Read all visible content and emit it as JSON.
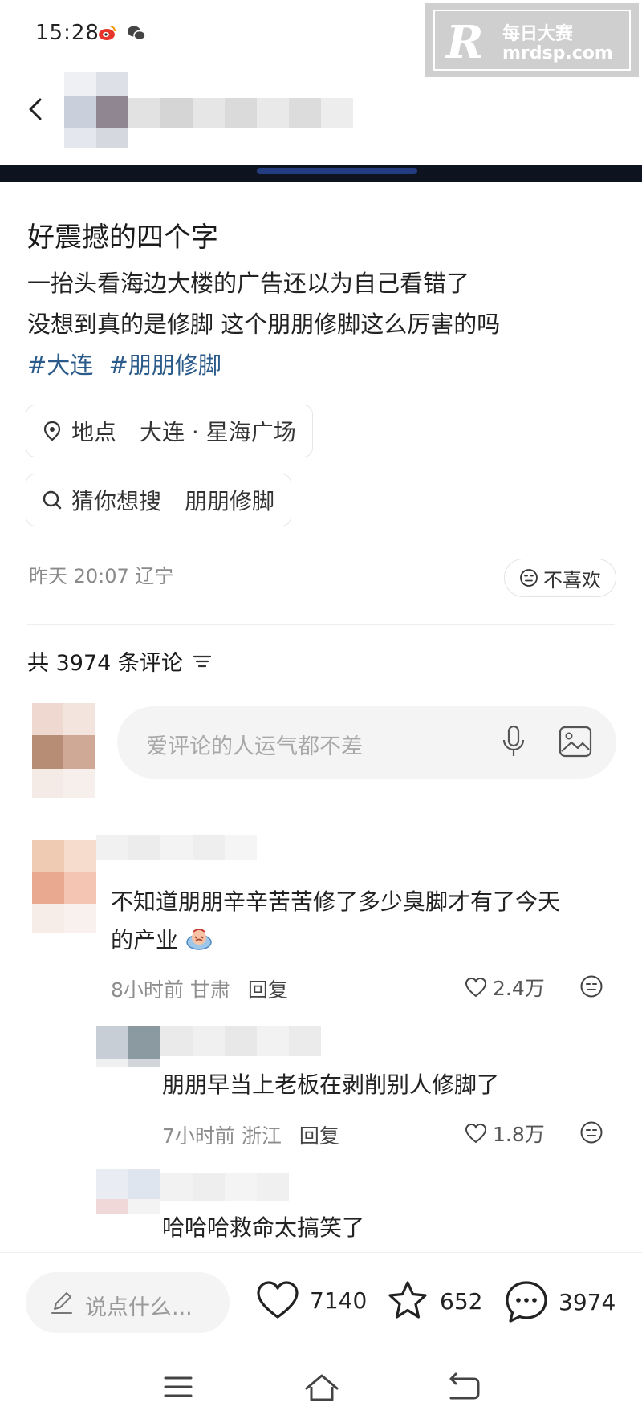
{
  "status_bar": {
    "time": "15:28"
  },
  "watermark": {
    "brand_cn": "每日大赛",
    "brand_en": "mrdsp.com"
  },
  "post": {
    "title": "好震撼的四个字",
    "lines": [
      "一抬头看海边大楼的广告还以为自己看错了",
      "没想到真的是修脚 这个朋朋修脚这么厉害的吗"
    ],
    "tags": [
      "#大连",
      "#朋朋修脚"
    ]
  },
  "location_chip": {
    "label": "地点",
    "value": "大连 · 星海广场"
  },
  "search_chip": {
    "label": "猜你想搜",
    "value": "朋朋修脚"
  },
  "meta": {
    "time_place": "昨天 20:07 辽宁",
    "dislike_label": "不喜欢"
  },
  "comments_header": {
    "label": "共 3974 条评论"
  },
  "comment_input": {
    "placeholder": "爱评论的人运气都不差"
  },
  "comments": [
    {
      "text_line1": "不知道朋朋辛辛苦苦修了多少臭脚才有了今天",
      "text_line2": "的产业",
      "time_place": "8小时前 甘肃",
      "reply": "回复",
      "likes": "2.4万"
    },
    {
      "text": "朋朋早当上老板在剥削别人修脚了",
      "time_place": "7小时前 浙江",
      "reply": "回复",
      "likes": "1.8万"
    },
    {
      "text": "哈哈哈救命太搞笑了"
    }
  ],
  "bottom_bar": {
    "say_placeholder": "说点什么...",
    "likes": "7140",
    "favorites": "652",
    "comments": "3974"
  },
  "colors": {
    "tag": "#2b5b8a",
    "muted": "#8a8a8a",
    "input_bg": "#f4f4f4"
  }
}
